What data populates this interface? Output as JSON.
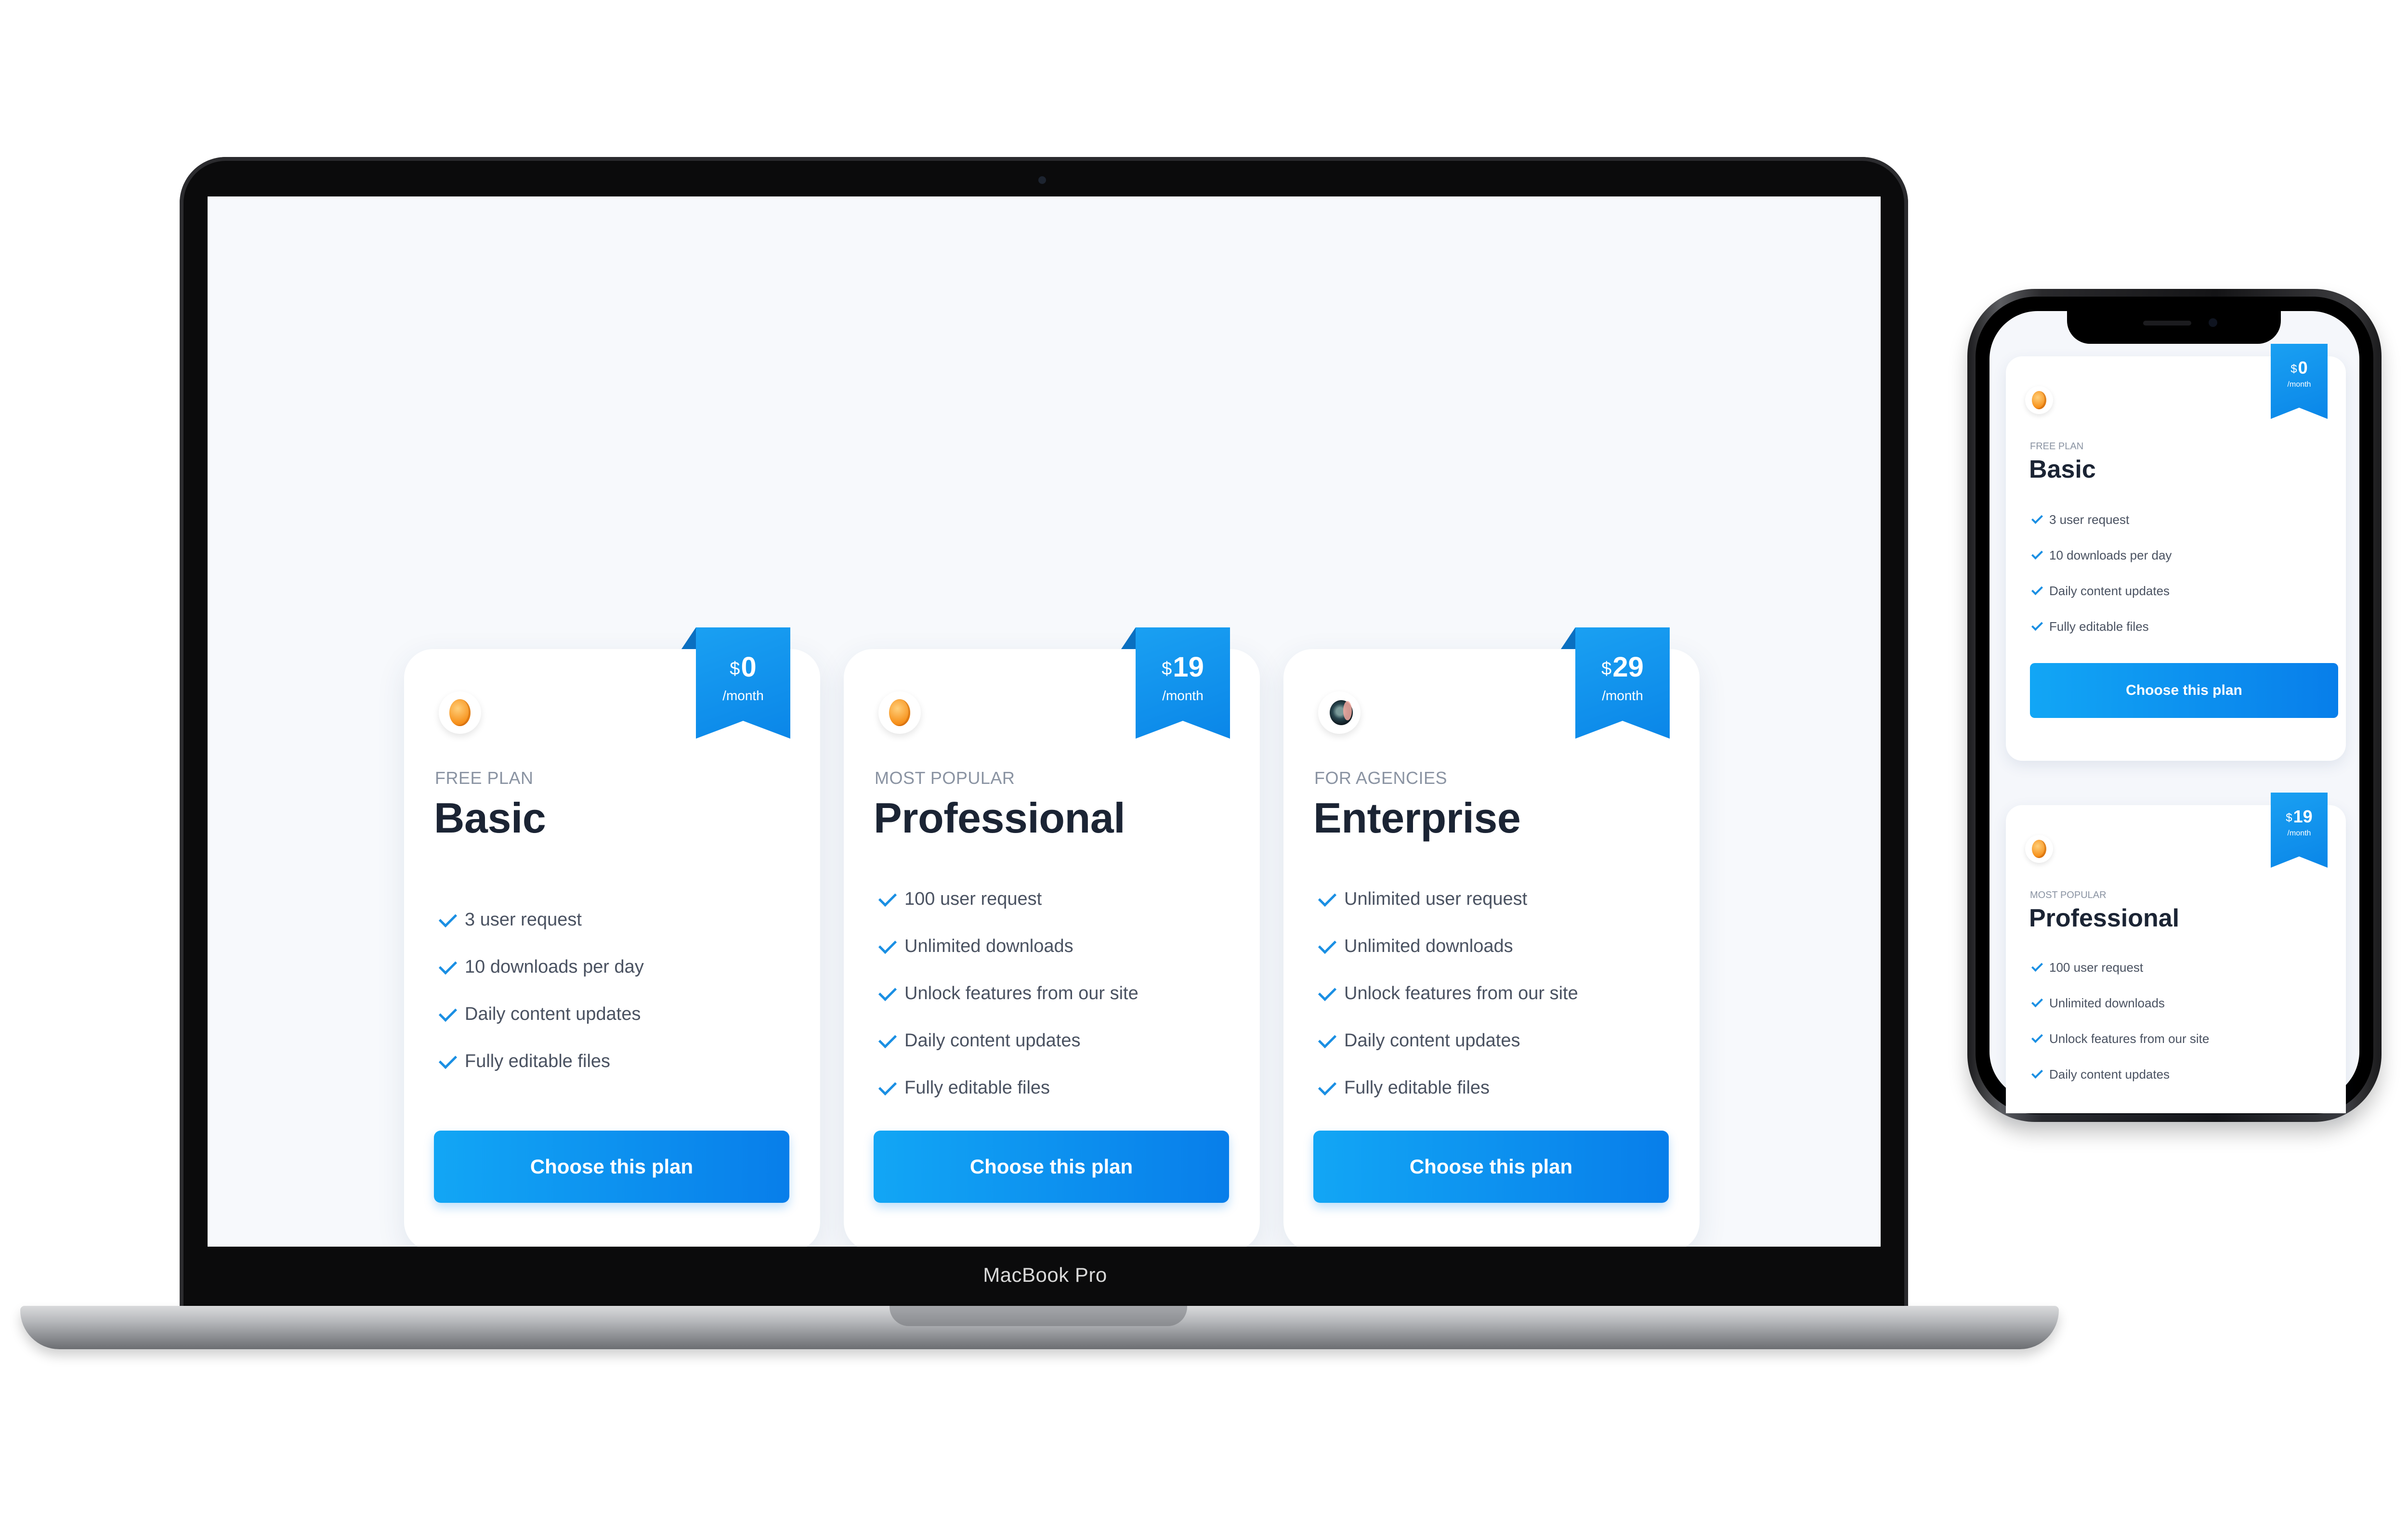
{
  "device_labels": {
    "laptop": "MacBook Pro"
  },
  "colors": {
    "accent": "#0a86e8",
    "accent_light": "#12a6f5",
    "title": "#1b2434",
    "muted": "#8a93a2",
    "body_text": "#4a5261",
    "screen_bg": "#f7f9fc"
  },
  "plans": [
    {
      "label": "FREE PLAN",
      "title": "Basic",
      "currency": "$",
      "price": "0",
      "period": "/month",
      "icon": "orange-coin-icon",
      "features": [
        "3 user request",
        "10 downloads per day",
        "Daily content updates",
        "Fully editable files"
      ],
      "button": "Choose this plan"
    },
    {
      "label": "MOST POPULAR",
      "title": "Professional",
      "currency": "$",
      "price": "19",
      "period": "/month",
      "icon": "orange-coin-icon",
      "features": [
        "100 user request",
        "Unlimited downloads",
        "Unlock features from our site",
        "Daily content updates",
        "Fully editable files"
      ],
      "button": "Choose this plan"
    },
    {
      "label": "FOR AGENCIES",
      "title": "Enterprise",
      "currency": "$",
      "price": "29",
      "period": "/month",
      "icon": "dark-disc-icon",
      "features": [
        "Unlimited user request",
        "Unlimited downloads",
        "Unlock features from our site",
        "Daily content updates",
        "Fully editable files"
      ],
      "button": "Choose this plan"
    }
  ],
  "mobile": {
    "cards": [
      {
        "label": "FREE PLAN",
        "title": "Basic",
        "currency": "$",
        "price": "0",
        "period": "/month",
        "features": [
          "3 user request",
          "10 downloads per day",
          "Daily content updates",
          "Fully editable files"
        ],
        "button": "Choose this plan"
      },
      {
        "label": "MOST POPULAR",
        "title": "Professional",
        "currency": "$",
        "price": "19",
        "period": "/month",
        "features": [
          "100 user request",
          "Unlimited downloads",
          "Unlock features from our site",
          "Daily content updates"
        ]
      }
    ]
  }
}
